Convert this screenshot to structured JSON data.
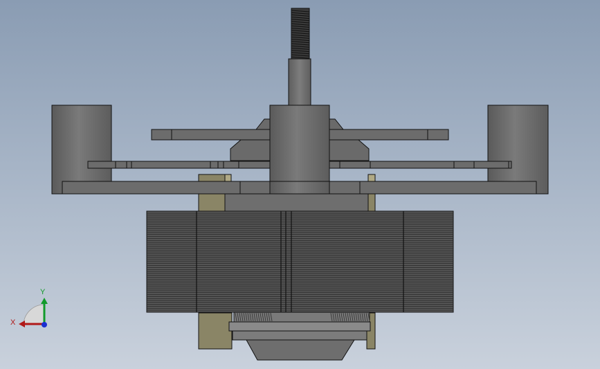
{
  "viewport": {
    "background_top": "#8a9cb3",
    "background_bottom": "#c9d1dc"
  },
  "model": {
    "part_fill": "#6f6f6f",
    "part_fill_light": "#8a8a8a",
    "part_fill_dark": "#4e4e4e",
    "tan_fill": "#8a8566",
    "edge_color": "#111111"
  },
  "triad": {
    "x_label": "X",
    "y_label": "Y",
    "x_color": "#b01818",
    "y_color": "#129a2a",
    "z_color": "#1b2fd0"
  }
}
